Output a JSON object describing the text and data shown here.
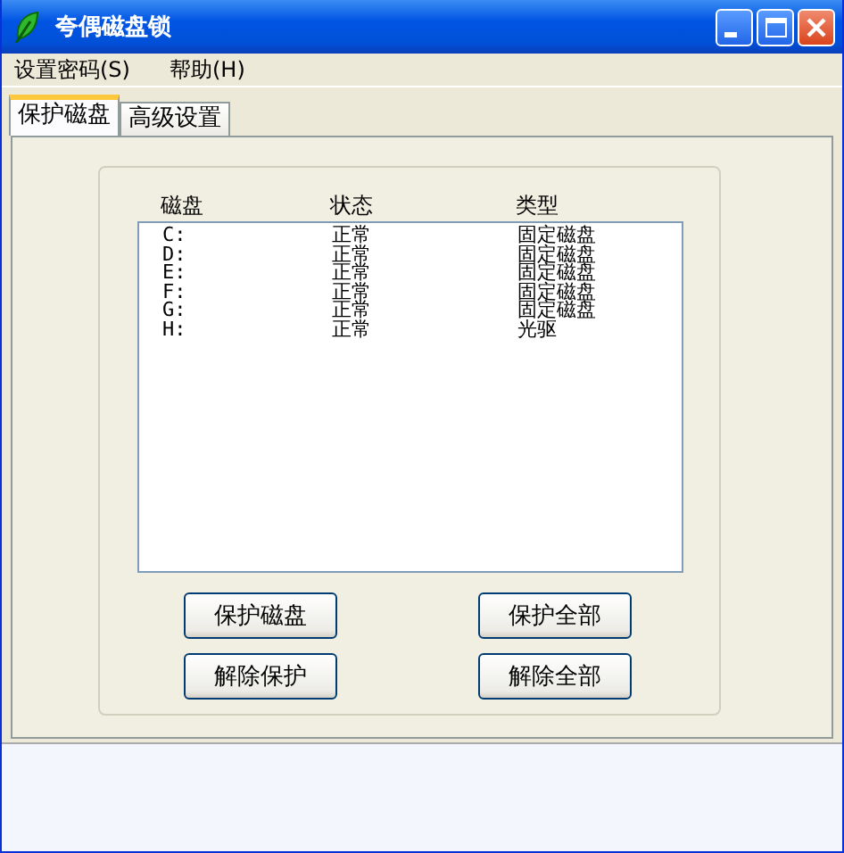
{
  "window": {
    "title": "夸偶磁盘锁"
  },
  "menu": [
    "设置密码(S)",
    "帮助(H)"
  ],
  "tabs": [
    {
      "label": "保护磁盘",
      "selected": true
    },
    {
      "label": "高级设置",
      "selected": false
    }
  ],
  "table": {
    "columns": [
      "磁盘",
      "状态",
      "类型"
    ],
    "rows": [
      [
        "C:",
        "正常",
        "固定磁盘"
      ],
      [
        "D:",
        "正常",
        "固定磁盘"
      ],
      [
        "E:",
        "正常",
        "固定磁盘"
      ],
      [
        "F:",
        "正常",
        "固定磁盘"
      ],
      [
        "G:",
        "正常",
        "固定磁盘"
      ],
      [
        "H:",
        "正常",
        "光驱"
      ]
    ]
  },
  "buttons": [
    [
      "保护磁盘",
      "保护全部"
    ],
    [
      "解除保护",
      "解除全部"
    ]
  ]
}
